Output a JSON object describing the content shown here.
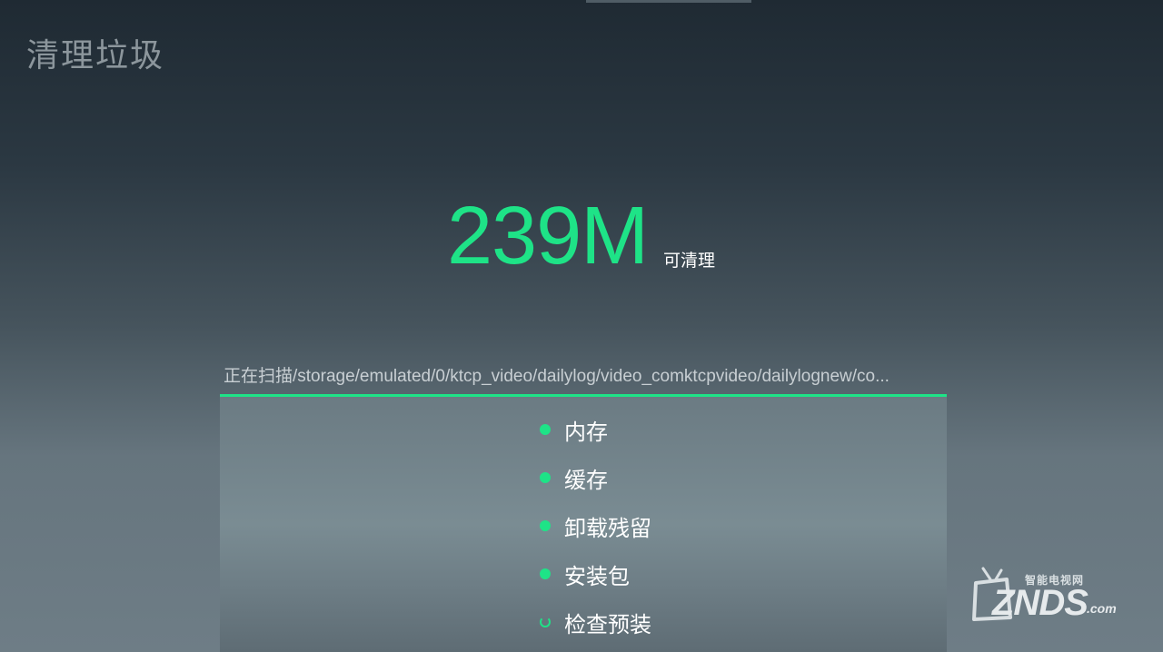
{
  "header": {
    "title": "清理垃圾"
  },
  "summary": {
    "size": "239M",
    "suffix": "可清理"
  },
  "scan": {
    "status_path": "正在扫描/storage/emulated/0/ktcp_video/dailylog/video_comktcpvideo/dailylognew/co..."
  },
  "categories": [
    {
      "label": "内存",
      "state": "done"
    },
    {
      "label": "缓存",
      "state": "done"
    },
    {
      "label": "卸载残留",
      "state": "done"
    },
    {
      "label": "安装包",
      "state": "done"
    },
    {
      "label": "检查预装",
      "state": "scanning"
    }
  ],
  "watermark": {
    "sub": "智能电视网",
    "main": "ZNDS",
    "domain": ".com"
  },
  "colors": {
    "accent": "#1ee387",
    "title": "#8c969c"
  }
}
